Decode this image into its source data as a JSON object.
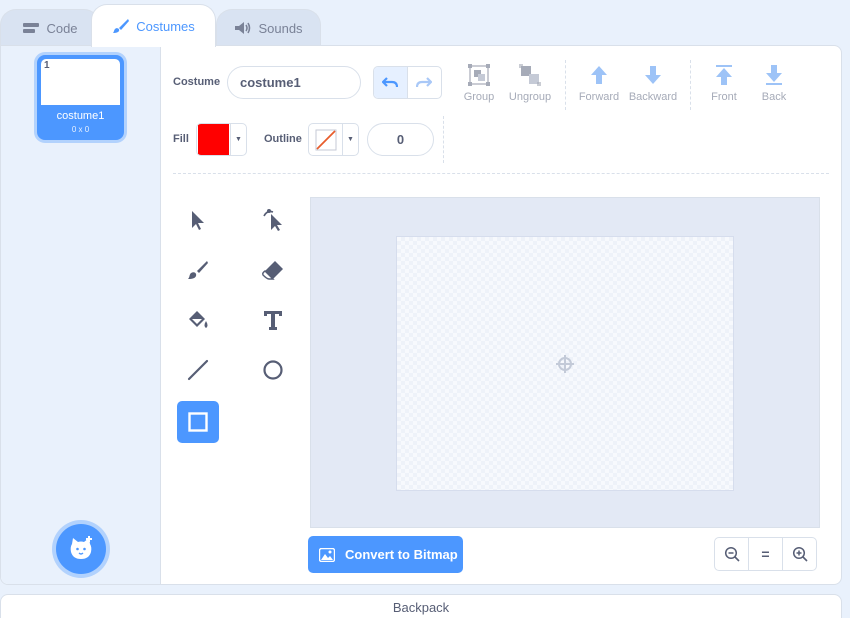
{
  "tabs": [
    {
      "label": "Code",
      "icon": "code-icon"
    },
    {
      "label": "Costumes",
      "icon": "brush-icon",
      "active": true
    },
    {
      "label": "Sounds",
      "icon": "speaker-icon"
    }
  ],
  "costume_list": {
    "items": [
      {
        "number": "1",
        "name": "costume1",
        "size": "0 x 0",
        "selected": true
      }
    ],
    "add_button_icon": "add-costume-cat-icon"
  },
  "editor": {
    "costume_label": "Costume",
    "costume_name": "costume1",
    "actions": {
      "group": "Group",
      "ungroup": "Ungroup",
      "forward": "Forward",
      "backward": "Backward",
      "front": "Front",
      "back": "Back"
    },
    "fill_label": "Fill",
    "fill_color": "#ff0000",
    "outline_label": "Outline",
    "outline_color": "none",
    "outline_width": "0",
    "tools": [
      "select",
      "reshape",
      "brush",
      "eraser",
      "fill",
      "text",
      "line",
      "circle",
      "rectangle"
    ],
    "selected_tool": "rectangle",
    "convert_button": "Convert to Bitmap",
    "zoom": {
      "zoom_out": "zoom-out-icon",
      "reset": "=",
      "zoom_in": "zoom-in-icon"
    }
  },
  "backpack": {
    "label": "Backpack"
  },
  "colors": {
    "accent": "#4c97ff",
    "text": "#575e75",
    "background": "#e9f1fc"
  }
}
